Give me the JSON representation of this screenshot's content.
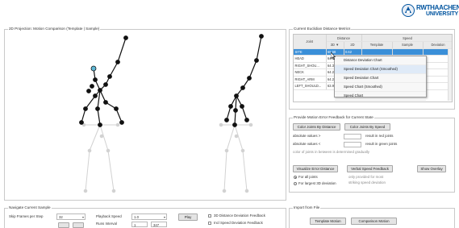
{
  "logo": {
    "line1": "RWTHAACHEN",
    "line2": "UNIVERSITY"
  },
  "projection": {
    "title": "2D Projection: Motion Comparison (Template | Sample)"
  },
  "metrics": {
    "title": "Current Euclidian Distance Metrics",
    "group_headers": [
      "Distance",
      "Speed"
    ],
    "columns": [
      "Joint",
      "3D",
      "2D",
      "Template",
      "Sample",
      "Deviation"
    ],
    "sort_indicator": "▼",
    "rows": [
      [
        "SITE",
        "65.58",
        "0.62",
        "",
        "",
        ""
      ],
      [
        "HEAD",
        "64.47",
        "0.54",
        "",
        "",
        ""
      ],
      [
        "RIGHT_SHOU...",
        "64.39",
        "6.07",
        "",
        "",
        ""
      ],
      [
        "NECK",
        "64.24",
        "6.69",
        "",
        "",
        ""
      ],
      [
        "RIGHT_ARM",
        "64.22",
        "1.21",
        "",
        "",
        ""
      ],
      [
        "LEFT_SHOULD...",
        "63.98",
        "9.1",
        "",
        "",
        ""
      ]
    ],
    "selected_row": 0
  },
  "context_menu": {
    "items": [
      "Distance Deviation Chart",
      "Speed Deviation Chart (Smoothed)",
      "Speed Deviation Chart",
      "Speed Chart (Smoothed)",
      "Speed Chart"
    ]
  },
  "feedback": {
    "title": "Provide Motion Error Feedback for Current State",
    "color_by_distance": "Color Joints By Distance",
    "color_by_speed": "Color Joints By Speed",
    "abs_label_1": "absolute values >",
    "abs_result_1": "result in red joints",
    "abs_label_2": "absolute values <",
    "abs_result_2": "result in green joints",
    "gradual_note": "color of joints in between is determined gradually",
    "visualize_button": "Visualize Error Distance",
    "verbal_button": "Verbal Speed Feedback",
    "overlay_button": "Show Overlay",
    "radio_all": "For all joints",
    "radio_largest": "For largest 3D deviation",
    "verbal_note_1": "only provided for most",
    "verbal_note_2": "striking speed deviation"
  },
  "navigate": {
    "title": "Navigate Current Sample",
    "skip_label": "Skip Frames per Step",
    "skip_value": "32",
    "playback_label": "Playback Speed",
    "playback_value": "1.0",
    "play_button": "Play",
    "runs_label": "Runs Interval",
    "runs_from": "1",
    "runs_to": "347",
    "check_distance": "3D Distance Deviation Feedback",
    "check_speed": "Incl Speed Deviation Feedback"
  },
  "import": {
    "title": "Import from File",
    "template_button": "Template Motion",
    "comparison_button": "Comparison Motion"
  },
  "colors": {
    "accent": "#3a8fd8",
    "rwth_blue": "#00549f",
    "joint_active": "#111111",
    "joint_ghost": "#cccccc",
    "joint_highlight": "#5fb8d6"
  }
}
